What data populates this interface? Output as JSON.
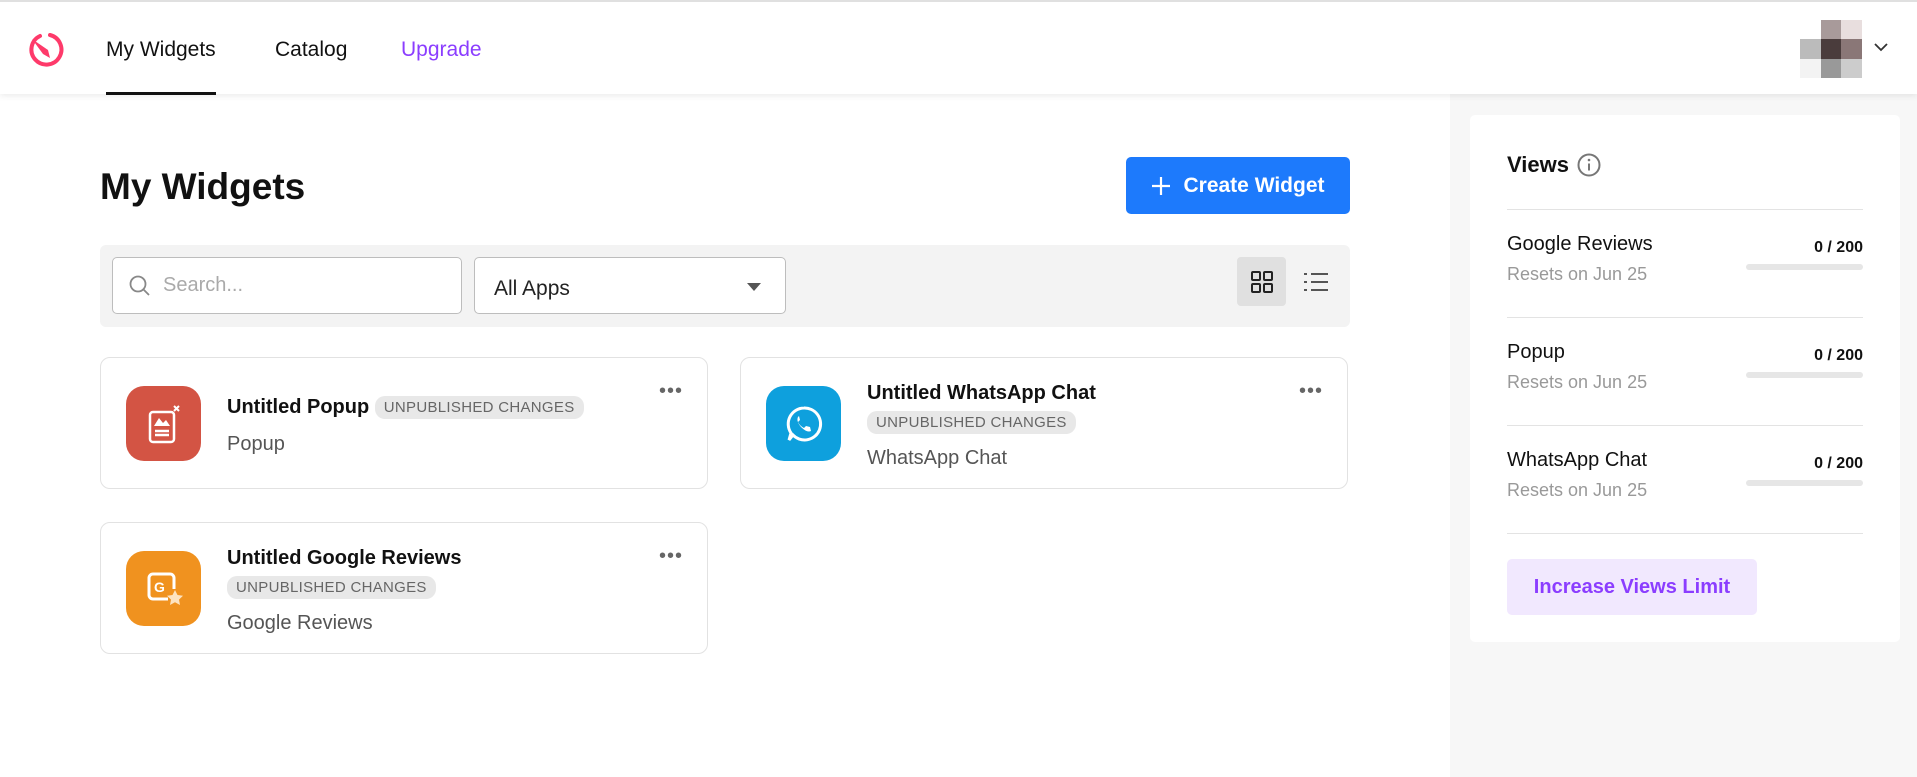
{
  "nav": {
    "items": [
      {
        "label": "My Widgets",
        "active": true
      },
      {
        "label": "Catalog"
      },
      {
        "label": "Upgrade"
      }
    ],
    "upgrade_color": "#8b3dff"
  },
  "main": {
    "title": "My Widgets",
    "create_label": "Create Widget",
    "search_placeholder": "Search...",
    "app_filter": "All Apps",
    "widgets": [
      {
        "name": "Untitled Popup",
        "badge": "UNPUBLISHED CHANGES",
        "type": "Popup",
        "color": "#d35444"
      },
      {
        "name": "Untitled WhatsApp Chat",
        "badge": "UNPUBLISHED CHANGES",
        "type": "WhatsApp Chat",
        "color": "#0ea0dd"
      },
      {
        "name": "Untitled Google Reviews",
        "badge": "UNPUBLISHED CHANGES",
        "type": "Google Reviews",
        "color": "#f0921f"
      }
    ]
  },
  "views": {
    "title": "Views",
    "items": [
      {
        "name": "Google Reviews",
        "reset": "Resets on Jun 25",
        "count": "0 / 200",
        "used": 0,
        "limit": 200
      },
      {
        "name": "Popup",
        "reset": "Resets on Jun 25",
        "count": "0 / 200",
        "used": 0,
        "limit": 200
      },
      {
        "name": "WhatsApp Chat",
        "reset": "Resets on Jun 25",
        "count": "0 / 200",
        "used": 0,
        "limit": 200
      }
    ],
    "increase_label": "Increase Views Limit"
  }
}
